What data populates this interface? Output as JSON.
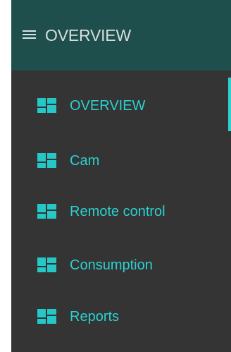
{
  "header": {
    "title": "OVERVIEW",
    "menu_icon": "hamburger-menu-icon"
  },
  "nav": {
    "items": [
      {
        "label": "OVERVIEW",
        "icon": "dashboard-tile-icon",
        "active": true
      },
      {
        "label": "Cam",
        "icon": "dashboard-tile-icon",
        "active": false
      },
      {
        "label": "Remote control",
        "icon": "dashboard-tile-icon",
        "active": false
      },
      {
        "label": "Consumption",
        "icon": "dashboard-tile-icon",
        "active": false
      },
      {
        "label": "Reports",
        "icon": "dashboard-tile-icon",
        "active": false
      }
    ]
  },
  "colors": {
    "header_bg": "#1f4f4c",
    "drawer_bg": "#343434",
    "accent": "#2bd1d1",
    "icon": "#25c7c7",
    "header_text": "#d6dfdd"
  }
}
